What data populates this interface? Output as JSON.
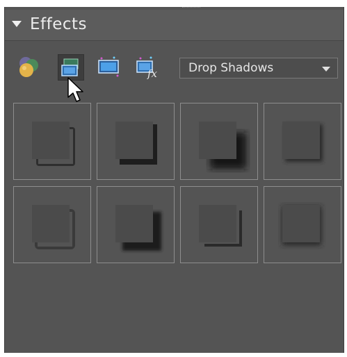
{
  "panel": {
    "title": "Effects",
    "collapse_icon": "triangle-down-icon"
  },
  "toolbar": {
    "icons": [
      {
        "name": "layer-styles-icon",
        "active": false
      },
      {
        "name": "filters-icon",
        "active": true
      },
      {
        "name": "photo-effects-icon",
        "active": false
      },
      {
        "name": "fx-all-effects-icon",
        "active": false
      }
    ],
    "dropdown_value": "Drop Shadows"
  },
  "effects_grid": {
    "rows": 2,
    "columns": 4,
    "items": [
      "drop-shadow-1",
      "drop-shadow-2",
      "drop-shadow-3",
      "drop-shadow-4",
      "drop-shadow-5",
      "drop-shadow-6",
      "drop-shadow-7",
      "drop-shadow-8"
    ]
  },
  "colors": {
    "panel_bg": "#545454",
    "tile_border": "#8e8e8e",
    "text": "#ececec"
  }
}
